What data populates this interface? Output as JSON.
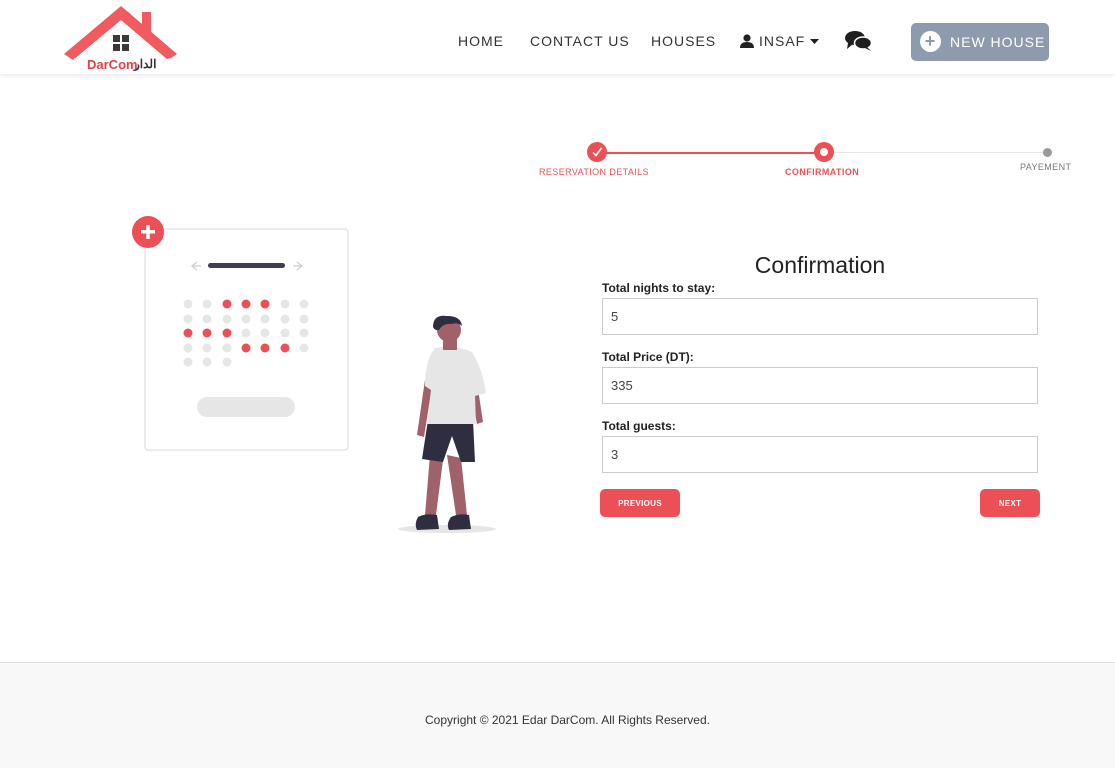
{
  "brand": {
    "name_latin": "DarCom",
    "name_arabic": "الدار",
    "accent_color": "#ec5056",
    "nav_button_color": "#8e9aae"
  },
  "nav": {
    "home": "HOME",
    "contact": "CONTACT US",
    "houses": "HOUSES",
    "user": "INSAF",
    "new_house": "NEW HOUSE"
  },
  "stepper": {
    "steps": [
      {
        "label": "RESERVATION DETAILS",
        "state": "done"
      },
      {
        "label": "CONFIRMATION",
        "state": "active"
      },
      {
        "label": "PAYEMENT",
        "state": "pending"
      }
    ]
  },
  "form": {
    "title": "Confirmation",
    "nights_label": "Total nights to stay:",
    "nights_value": "5",
    "price_label": "Total Price (DT):",
    "price_value": "335",
    "guests_label": "Total guests:",
    "guests_value": "3",
    "previous": "PREVIOUS",
    "next": "NEXT"
  },
  "footer": {
    "copyright": "Copyright © 2021 Edar DarCom. All Rights Reserved."
  }
}
